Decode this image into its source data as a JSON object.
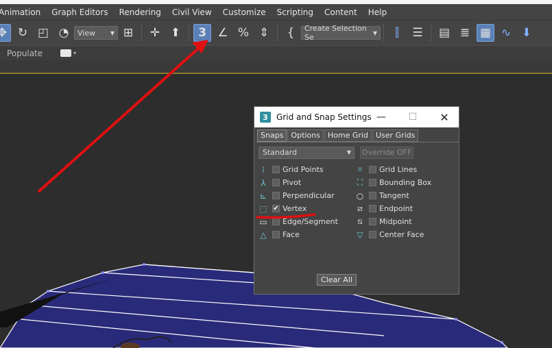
{
  "menu": {
    "items": [
      "Animation",
      "Graph Editors",
      "Rendering",
      "Civil View",
      "Customize",
      "Scripting",
      "Content",
      "Help"
    ]
  },
  "toolbar": {
    "view_dropdown": "View",
    "selection_set": "Create Selection Se",
    "snap_number": "3"
  },
  "ribbon": {
    "populate_label": "Populate"
  },
  "dialog": {
    "title": "Grid and Snap Settings",
    "logo": "3",
    "minimize": "—",
    "maximize": "☐",
    "close": "✕",
    "tabs": [
      "Snaps",
      "Options",
      "Home Grid",
      "User Grids"
    ],
    "mode_select": "Standard",
    "override": "Override OFF",
    "snaps_left": [
      {
        "label": "Grid Points",
        "checked": false,
        "icon": "grid-points-icon"
      },
      {
        "label": "Pivot",
        "checked": false,
        "icon": "pivot-icon"
      },
      {
        "label": "Perpendicular",
        "checked": false,
        "icon": "perpendicular-icon"
      },
      {
        "label": "Vertex",
        "checked": true,
        "icon": "vertex-icon"
      },
      {
        "label": "Edge/Segment",
        "checked": false,
        "icon": "edge-segment-icon"
      },
      {
        "label": "Face",
        "checked": false,
        "icon": "face-icon"
      }
    ],
    "snaps_right": [
      {
        "label": "Grid Lines",
        "checked": false,
        "icon": "grid-lines-icon"
      },
      {
        "label": "Bounding Box",
        "checked": false,
        "icon": "bounding-box-icon"
      },
      {
        "label": "Tangent",
        "checked": false,
        "icon": "tangent-icon"
      },
      {
        "label": "Endpoint",
        "checked": false,
        "icon": "endpoint-icon"
      },
      {
        "label": "Midpoint",
        "checked": false,
        "icon": "midpoint-icon"
      },
      {
        "label": "Center Face",
        "checked": false,
        "icon": "center-face-icon"
      }
    ],
    "clear_all": "Clear All"
  },
  "colors": {
    "annotation": "#e01010",
    "mesh_fill": "#2a2a7a",
    "accent": "#5a80b8"
  }
}
